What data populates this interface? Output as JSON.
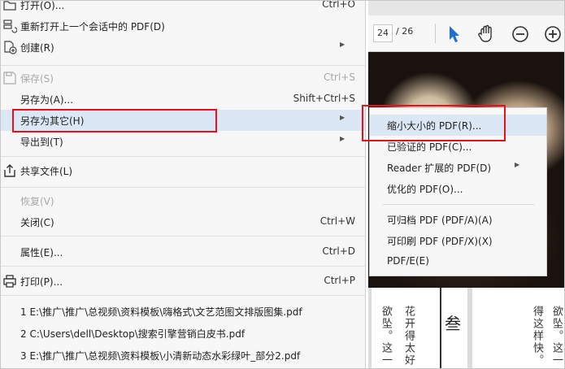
{
  "toolbar": {
    "page_current": "24",
    "page_total": "/ 26",
    "icons": [
      "select-arrow-icon",
      "hand-tool-icon",
      "zoom-out-icon",
      "zoom-in-icon"
    ]
  },
  "menu": {
    "items": [
      {
        "label": "打开(O)...",
        "shortcut": "Ctrl+O",
        "icon": "open-folder-icon"
      },
      {
        "label": "重新打开上一个会话中的 PDF(D)",
        "icon": "reopen-session-icon"
      },
      {
        "label": "创建(R)",
        "icon": "create-pdf-icon",
        "submenu": true
      },
      {
        "label": "保存(S)",
        "shortcut": "Ctrl+S",
        "icon": "save-icon",
        "disabled": true
      },
      {
        "label": "另存为(A)...",
        "shortcut": "Shift+Ctrl+S"
      },
      {
        "label": "另存为其它(H)",
        "submenu": true,
        "highlighted": true
      },
      {
        "label": "导出到(T)",
        "submenu": true
      },
      {
        "label": "共享文件(L)",
        "icon": "share-icon"
      },
      {
        "label": "恢复(V)",
        "disabled": true
      },
      {
        "label": "关闭(C)",
        "shortcut": "Ctrl+W"
      },
      {
        "label": "属性(E)...",
        "shortcut": "Ctrl+D"
      },
      {
        "label": "打印(P)...",
        "shortcut": "Ctrl+P",
        "icon": "print-icon"
      }
    ],
    "recent_files": [
      "1 E:\\推广\\推广\\总视频\\资料模板\\嗨格式\\文艺范图文排版图集.pdf",
      "2 C:\\Users\\dell\\Desktop\\搜索引擎营销白皮书.pdf",
      "3 E:\\推广\\推广\\总视频\\资料模板\\小清新动态水彩绿叶_部分2.pdf"
    ]
  },
  "submenu": {
    "items": [
      {
        "label": "缩小大小的 PDF(R)...",
        "highlighted": true
      },
      {
        "label": "已验证的 PDF(C)..."
      },
      {
        "label": "Reader 扩展的 PDF(D)",
        "submenu": true
      },
      {
        "label": "优化的 PDF(O)..."
      },
      {
        "label": "可归档 PDF (PDF/A)(A)"
      },
      {
        "label": "可印刷 PDF (PDF/X)(X)"
      },
      {
        "label": "PDF/E(E)"
      }
    ]
  },
  "document": {
    "page_left_col1": "欲坠。这一",
    "page_left_col2": "花开得太好",
    "page_left_heading": "叁",
    "page_right_col1": "得这样快。",
    "page_right_col2": "欲坠。这一"
  },
  "colors": {
    "highlight": "#dbe7f4",
    "annotation_box": "#e8101a",
    "toolbar_blue": "#1a6fd8"
  }
}
